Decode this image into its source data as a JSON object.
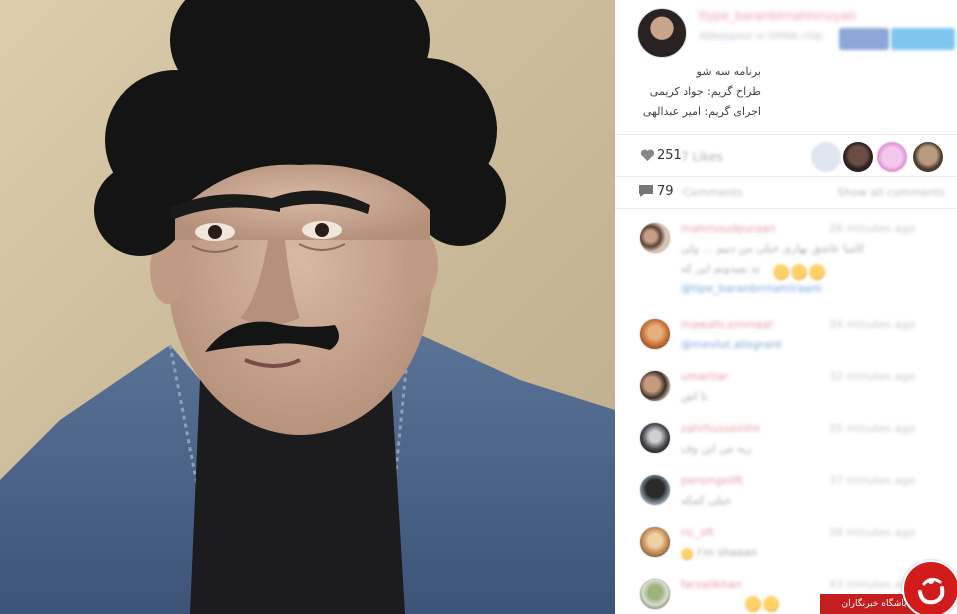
{
  "post": {
    "username": "tlype_baranblrnahhirsiyan",
    "subline": "Abbaspour sr OHNA chip",
    "share_facebook_label": "f",
    "share_twitter_label": "tweet"
  },
  "caption": {
    "line1": "برنامه سه شو",
    "line2": "طراح گریم: جواد کریمی",
    "line3": "اجرای گریم: امیر عبدالهی"
  },
  "likes": {
    "count": "251",
    "label": "7 Likes"
  },
  "comments_bar": {
    "count": "79",
    "label": "Comments",
    "show_all": "Show all comments"
  },
  "comments": [
    {
      "user": "mahmoudpuraan",
      "time": "26 minutes ago",
      "text": "کامیا عاشق بهاری خیلی من دنیم ... ولی",
      "text2": "نه نمیدونم این که",
      "link": "@tipe_baranbrrnahiiraam"
    },
    {
      "user": "mawahi.emmaal",
      "time": "34 minutes ago",
      "text": "@mevlut.alisgrant",
      "text2": "",
      "link": ""
    },
    {
      "user": "umartiar",
      "time": "32 minutes ago",
      "text": "تا اش",
      "text2": "",
      "link": ""
    },
    {
      "user": "zahrhusseinhii",
      "time": "35 minutes ago",
      "text": "زیه من این وف",
      "text2": "",
      "link": ""
    },
    {
      "user": "persingelift",
      "time": "37 minutes ago",
      "text": "خیلی کمکه",
      "text2": "",
      "link": ""
    },
    {
      "user": "ric_sft",
      "time": "38 minutes ago",
      "text": "I'm shaaan",
      "text2": "",
      "link": ""
    },
    {
      "user": "farzalikhan",
      "time": "43 minutes ago",
      "text": "",
      "text2": "",
      "link": ""
    }
  ],
  "watermark": {
    "label": "باشگاه خبرنگاران"
  },
  "colors": {
    "username_pink": "#e79aa6",
    "link_blue": "#7aa7d9",
    "brand_red": "#d21c1c"
  }
}
